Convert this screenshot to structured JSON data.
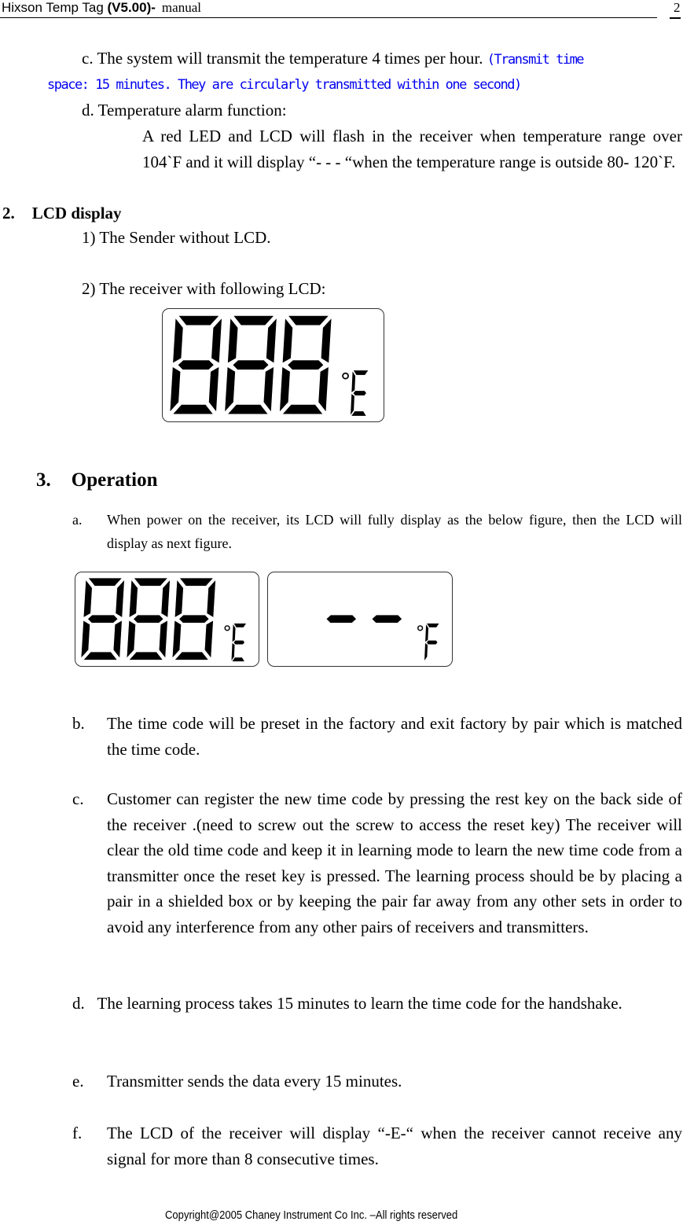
{
  "header": {
    "title_prefix": "Hixson Temp Tag ",
    "title_version": "(V5.00)-",
    "title_suffix": "manual",
    "page_number": "2"
  },
  "section1_tail": {
    "item_c": {
      "text": "c. The system will transmit the temperature 4 times per hour.",
      "note_line1": "(Transmit time",
      "note_line2": "space: 15 minutes. They are circularly transmitted within one second)",
      "note_color": "#0000f0"
    },
    "item_d": {
      "title": "d. Temperature alarm function:",
      "body": "A red LED and LCD will flash in the receiver when temperature range over 104`F and it will display “- - - “when the temperature range is outside 80- 120`F."
    }
  },
  "section2": {
    "number": "2.",
    "title": "LCD display",
    "item1": "1) The Sender without LCD.",
    "item2": "2) The receiver with following LCD:",
    "lcd_full": {
      "digits": [
        "8",
        "8",
        "8"
      ],
      "unit": "E",
      "degree": true
    }
  },
  "section3": {
    "number": "3.",
    "title": "Operation",
    "items": [
      {
        "label": "a.",
        "text": "When power on the receiver, its LCD will fully display as the below figure, then the LCD will display as next figure."
      },
      {
        "label": "b.",
        "text": "The time code will be preset in the factory and exit factory by pair which is matched the time code."
      },
      {
        "label": "c.",
        "text": "Customer can register the new time code by pressing the rest key on the back side of the receiver .(need to screw out the screw to access the reset key) The receiver will clear the old time code and keep it in learning mode to learn the new time code from a transmitter once the reset key is pressed. The learning process should be by placing a pair in a shielded box or by keeping the pair far away from any other sets in order to avoid any interference from any other pairs of receivers and transmitters."
      },
      {
        "label": "d.",
        "text": "The learning process takes 15 minutes to learn the time code for the handshake."
      },
      {
        "label": "e.",
        "text": "Transmitter sends the data every 15 minutes."
      },
      {
        "label": "f.",
        "text": "The LCD of the receiver will display “-E-“ when the receiver cannot receive any signal for more than 8 consecutive times."
      }
    ],
    "lcd_startup": {
      "digits": [
        "8",
        "8",
        "8"
      ],
      "unit": "E",
      "degree": true
    },
    "lcd_next": {
      "digits": [
        " ",
        "-",
        "-"
      ],
      "unit": "F",
      "degree": true
    }
  },
  "footer": {
    "copyright": "Copyright@2005 Chaney Instrument Co Inc.     –All rights reserved"
  }
}
